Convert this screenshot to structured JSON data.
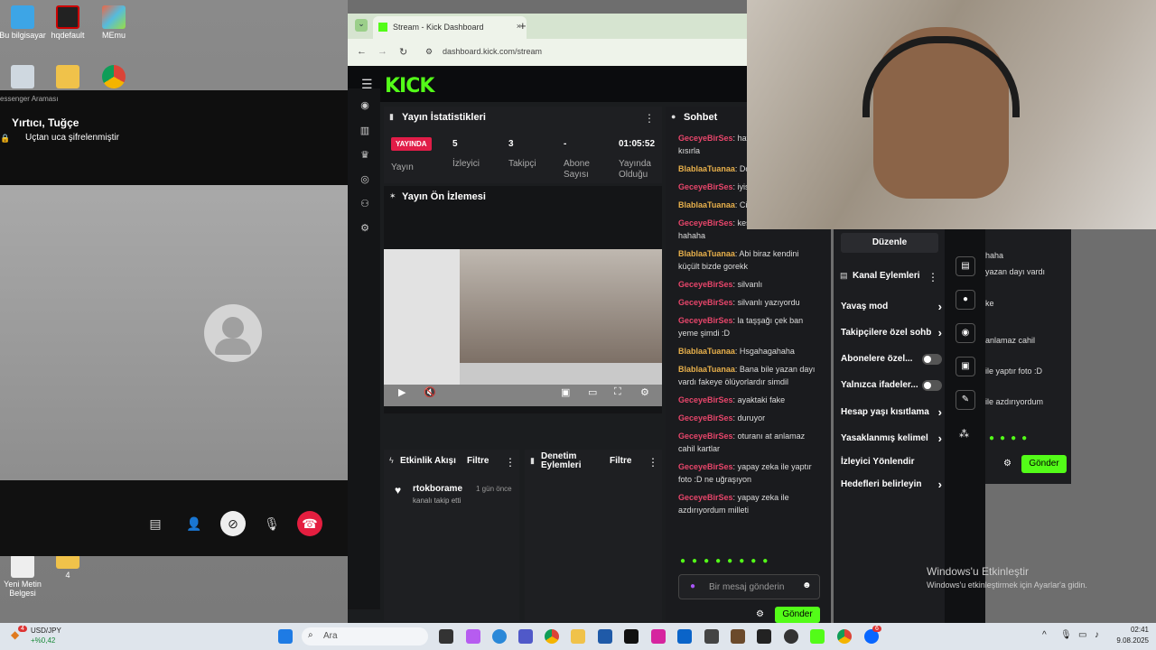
{
  "desktop": {
    "icons": [
      {
        "label": "Bu bilgisayar"
      },
      {
        "label": "hqdefault"
      },
      {
        "label": "MEmu"
      },
      {
        "label": "Yeni Metin Belgesi"
      },
      {
        "label": "4"
      }
    ]
  },
  "messenger": {
    "window_label": "essenger Araması",
    "contact": "Yırtıcı, Tuğçe",
    "encryption": "Uçtan uca şifrelenmiştir"
  },
  "browser": {
    "tab_title": "Stream - Kick Dashboard",
    "url": "dashboard.kick.com/stream"
  },
  "kick": {
    "logo": "KICK",
    "stats": {
      "title": "Yayın İstatistikleri",
      "live_badge": "YAYINDA",
      "live_label": "Yayın",
      "viewers": "5",
      "viewers_label": "İzleyici",
      "followers": "3",
      "followers_label": "Takipçi",
      "subs": "-",
      "subs_label": "Abone Sayısı",
      "uptime": "01:05:52",
      "uptime_label": "Yayında Olduğu"
    },
    "preview": {
      "title": "Yayın Ön İzlemesi"
    },
    "activity": {
      "title": "Etkinlik Akışı",
      "filter": "Filtre",
      "user": "rtokborame",
      "time": "1 gün önce",
      "action": "kanalı takip etti"
    },
    "moderation": {
      "title": "Denetim Eylemleri",
      "filter": "Filtre"
    },
    "chat": {
      "title": "Sohbet",
      "messages": [
        {
          "user": "GeceyeBirSes",
          "text": "hat yaştan sonra kısırla",
          "c": 1
        },
        {
          "user": "BlablaaTuanaa",
          "text": "Do verdiğim dayı",
          "c": 2
        },
        {
          "user": "GeceyeBirSes",
          "text": "iyis bilemeyiz",
          "c": 1
        },
        {
          "user": "BlablaaTuanaa",
          "text": "Cidai ilişki istio bide",
          "c": 2
        },
        {
          "user": "GeceyeBirSes",
          "text": "kesin malafatı açıktır hahaha",
          "c": 1
        },
        {
          "user": "BlablaaTuanaa",
          "text": "Abi biraz kendini küçült bizde gorekk",
          "c": 2
        },
        {
          "user": "GeceyeBirSes",
          "text": "silvanlı",
          "c": 1
        },
        {
          "user": "GeceyeBirSes",
          "text": "silvanlı yazıyordu",
          "c": 1
        },
        {
          "user": "GeceyeBirSes",
          "text": "la taşşağı çek ban yeme şimdi :D",
          "c": 1
        },
        {
          "user": "BlablaaTuanaa",
          "text": "Hsgahagahaha",
          "c": 2
        },
        {
          "user": "BlablaaTuanaa",
          "text": "Bana bile yazan dayı vardı fakeye ölüyorlardır simdil",
          "c": 2
        },
        {
          "user": "GeceyeBirSes",
          "text": "ayaktaki fake",
          "c": 1
        },
        {
          "user": "GeceyeBirSes",
          "text": "duruyor",
          "c": 1
        },
        {
          "user": "GeceyeBirSes",
          "text": "oturanı at anlamaz cahil kartlar",
          "c": 1
        },
        {
          "user": "GeceyeBirSes",
          "text": "yapay zeka ile yaptır foto :D ne uğraşıyon",
          "c": 1
        },
        {
          "user": "GeceyeBirSes",
          "text": "yapay zeka ile azdırıyordum milleti",
          "c": 1
        }
      ],
      "placeholder": "Bir mesaj gönderin",
      "send": "Gönder"
    },
    "channel_actions": {
      "edit": "Düzenle",
      "title": "Kanal Eylemleri",
      "items": [
        {
          "label": "Yavaş mod"
        },
        {
          "label": "Takipçilere özel sohb"
        },
        {
          "label": "Abonelere özel..."
        },
        {
          "label": "Yalnızca ifadeler..."
        },
        {
          "label": "Hesap yaşı kısıtlama"
        },
        {
          "label": "Yasaklanmış kelimel"
        },
        {
          "label": "İzleyici Yönlendir"
        },
        {
          "label": "Hedefleri belirleyin"
        }
      ]
    }
  },
  "second_panel": {
    "lines": [
      "haha",
      "yazan dayı vardı",
      "ke",
      "anlamaz cahil",
      "ile yaptır foto :D",
      "ile azdırıyordum"
    ],
    "send": "Gönder"
  },
  "watermark": {
    "title": "Windows'u Etkinleştir",
    "sub": "Windows'u etkinleştirmek için Ayarlar'a gidin."
  },
  "taskbar": {
    "ticker": "USD/JPY",
    "change": "+%0,42",
    "badge": "4",
    "search": "Ara",
    "time": "02:41",
    "date": "9.08.2025",
    "notif": "6"
  },
  "colors": {
    "kick_green": "#53fc18",
    "live_red": "#e11d48"
  }
}
